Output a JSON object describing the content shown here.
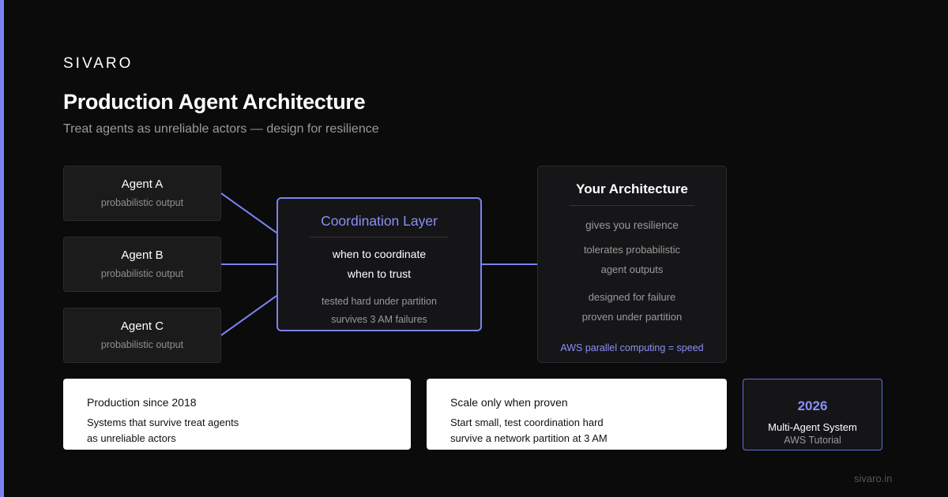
{
  "brand": "SIVARO",
  "title": "Production Agent Architecture",
  "subtitle": "Treat agents as unreliable actors — design for resilience",
  "agents": [
    {
      "name": "Agent A",
      "sub": "probabilistic output"
    },
    {
      "name": "Agent B",
      "sub": "probabilistic output"
    },
    {
      "name": "Agent C",
      "sub": "probabilistic output"
    }
  ],
  "coordination": {
    "title": "Coordination Layer",
    "line1": "when to coordinate",
    "line2": "when to trust",
    "line3": "tested hard under partition",
    "line4": "survives 3 AM failures"
  },
  "architecture": {
    "title": "Your Architecture",
    "line1": "gives you resilience",
    "line2": "tolerates probabilistic",
    "line3": "agent outputs",
    "line4": "designed for failure",
    "line5": "proven under partition",
    "line6": "AWS parallel computing = speed"
  },
  "cards": [
    {
      "title": "Production since 2018",
      "line1": "Systems that survive treat agents",
      "line2": "as unreliable actors"
    },
    {
      "title": "Scale only when proven",
      "line1": "Start small, test coordination hard",
      "line2": "survive a network partition at 3 AM"
    }
  ],
  "year_card": {
    "year": "2026",
    "line1": "Multi-Agent System",
    "line2": "AWS Tutorial"
  },
  "footer": "sivaro.in",
  "colors": {
    "accent": "#7b82f0",
    "background": "#0b0b0b",
    "card": "#ffffff"
  }
}
